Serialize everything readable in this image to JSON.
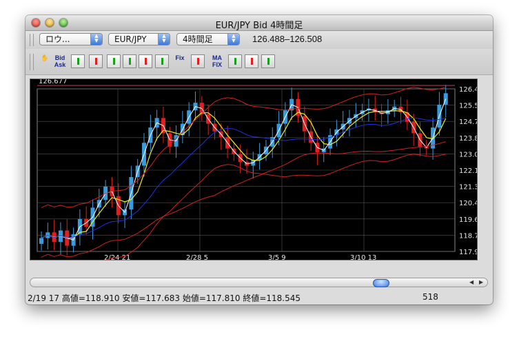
{
  "window": {
    "title": "EUR/JPY Bid 4時間足"
  },
  "toolbar": {
    "rate_type": "ロウ...",
    "pair": "EUR/JPY",
    "timeframe": "4時間足",
    "range": "126.488–126.508",
    "buttons": [
      {
        "name": "hand-tool-icon",
        "label": "✋"
      },
      {
        "name": "bid-ask-button",
        "label": "Bid Ask"
      },
      {
        "name": "bar-chart-icon",
        "label": ""
      },
      {
        "name": "line-chart-icon",
        "label": ""
      },
      {
        "name": "candle-icon-1",
        "label": ""
      },
      {
        "name": "candle-icon-2",
        "label": ""
      },
      {
        "name": "candle-icon-3",
        "label": ""
      },
      {
        "name": "candle-icon-4",
        "label": ""
      },
      {
        "name": "fix-button",
        "label": "Fix"
      },
      {
        "name": "arrow-icon",
        "label": ""
      },
      {
        "name": "ma-fix-button",
        "label": "MA FIX"
      },
      {
        "name": "indicator-icon",
        "label": ""
      },
      {
        "name": "pen-icon",
        "label": ""
      },
      {
        "name": "camera-icon",
        "label": ""
      }
    ]
  },
  "chart_data": {
    "type": "candlestick",
    "top_label": "126.677",
    "y_ticks": [
      "126.428",
      "125.575",
      "124.723",
      "123.870",
      "123.017",
      "122.164",
      "121.311",
      "120.458",
      "119.606",
      "118.753",
      "117.900"
    ],
    "ylim": [
      117.9,
      126.428
    ],
    "x_ticks": [
      "2/24 21",
      "2/28 5",
      "3/5 9",
      "3/10 13"
    ],
    "colors": {
      "up": "#3a9bdc",
      "down": "#e02020",
      "ma_short": "#ffffff",
      "ma_mid": "#f0f020",
      "ma_long": "#2030e0",
      "bollinger": "#d02020",
      "grid": "#555555"
    },
    "candles": [
      118.6,
      118.9,
      118.4,
      119.0,
      118.2,
      118.8,
      119.6,
      119.2,
      120.2,
      120.6,
      121.3,
      120.8,
      119.8,
      120.1,
      121.8,
      122.4,
      123.6,
      124.4,
      124.9,
      124.1,
      123.4,
      124.0,
      124.6,
      125.3,
      125.7,
      125.1,
      124.6,
      124.2,
      123.9,
      123.3,
      123.0,
      122.6,
      122.4,
      122.7,
      123.0,
      123.4,
      123.9,
      124.6,
      125.3,
      125.9,
      125.0,
      124.2,
      123.6,
      123.1,
      123.3,
      124.0,
      124.3,
      124.6,
      124.9,
      125.1,
      125.3,
      125.4,
      125.2,
      125.1,
      125.3,
      125.5,
      125.2,
      124.7,
      124.1,
      123.4,
      123.3,
      124.4,
      125.6,
      126.2
    ]
  },
  "status": {
    "left": "2/19 17 高値=118.910 安値=117.683 始値=117.810 終値=118.545",
    "right": "518"
  }
}
